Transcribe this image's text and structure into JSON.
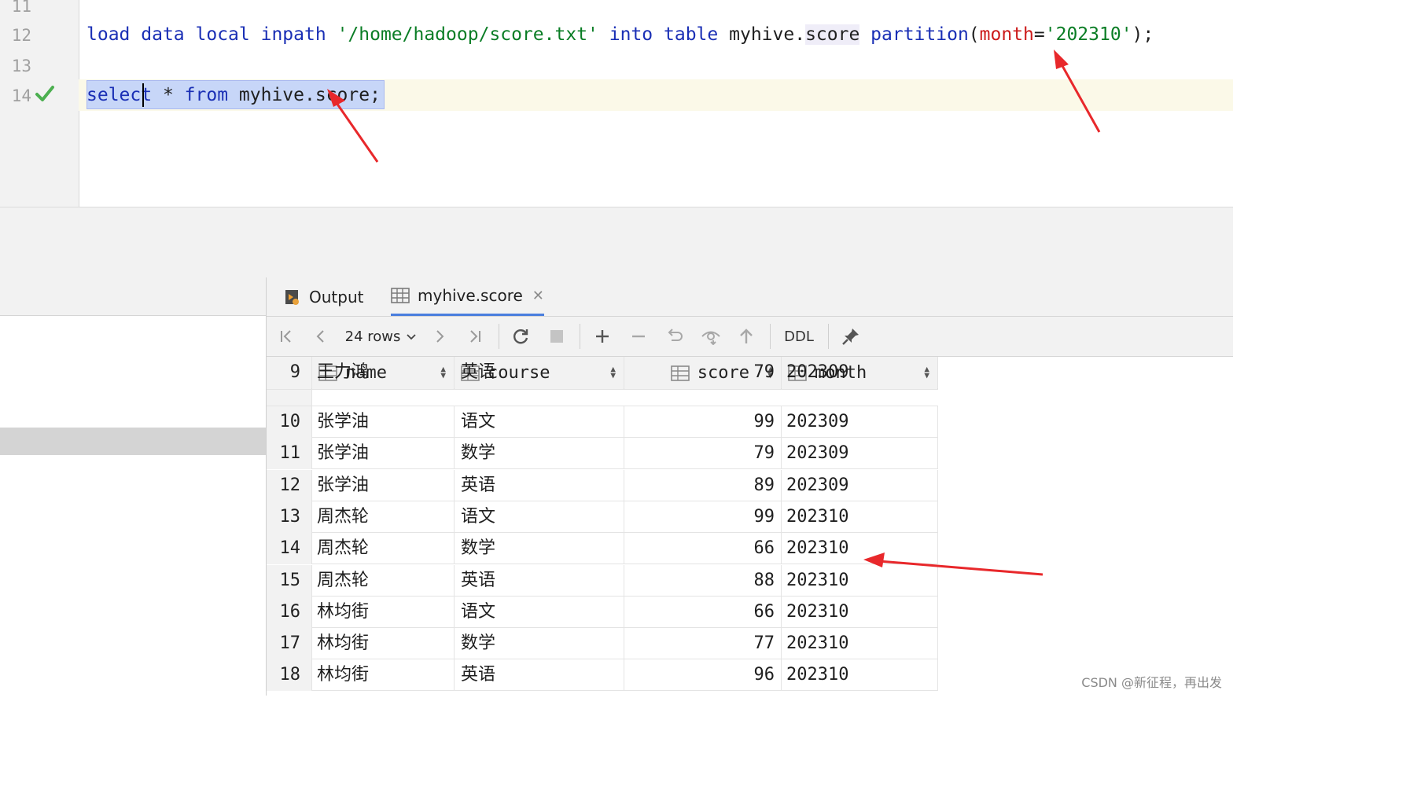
{
  "editor": {
    "line_numbers": [
      "11",
      "12",
      "13",
      "14"
    ],
    "line12": {
      "load": "load",
      "data": "data",
      "local": "local",
      "inpath": "inpath",
      "path": "'/home/hadoop/score.txt'",
      "into": "into",
      "table": "table",
      "table_ref_prefix": "myhive.",
      "table_ref_score": "score",
      "partition": "partition",
      "paren_open": "(",
      "part_key": "month",
      "equals": "=",
      "part_value": "'202310'",
      "tail": ");"
    },
    "line14": {
      "select": "select",
      "star": "*",
      "from": "from",
      "table_ref": "myhive.score",
      "semicolon": ";"
    }
  },
  "tabs": [
    {
      "label": "Output",
      "icon": "output-icon"
    },
    {
      "label": "myhive.score",
      "icon": "table-icon",
      "close": "✕"
    }
  ],
  "toolbar": {
    "rows_label": "24 rows",
    "ddl_label": "DDL",
    "icons": [
      "first-page-icon",
      "prev-page-icon",
      "next-page-icon",
      "last-page-icon",
      "refresh-icon",
      "stop-icon",
      "add-row-icon",
      "remove-row-icon",
      "revert-icon",
      "preview-icon",
      "submit-icon",
      "pin-icon"
    ]
  },
  "grid": {
    "columns": [
      "name",
      "course",
      "score",
      "month"
    ],
    "partial_row": {
      "num": "9",
      "name": "王力鸿",
      "course": "英语",
      "score": "79",
      "month": "202309"
    },
    "rows": [
      {
        "num": "10",
        "name": "张学油",
        "course": "语文",
        "score": "99",
        "month": "202309"
      },
      {
        "num": "11",
        "name": "张学油",
        "course": "数学",
        "score": "79",
        "month": "202309"
      },
      {
        "num": "12",
        "name": "张学油",
        "course": "英语",
        "score": "89",
        "month": "202309"
      },
      {
        "num": "13",
        "name": "周杰轮",
        "course": "语文",
        "score": "99",
        "month": "202310"
      },
      {
        "num": "14",
        "name": "周杰轮",
        "course": "数学",
        "score": "66",
        "month": "202310"
      },
      {
        "num": "15",
        "name": "周杰轮",
        "course": "英语",
        "score": "88",
        "month": "202310"
      },
      {
        "num": "16",
        "name": "林均街",
        "course": "语文",
        "score": "66",
        "month": "202310"
      },
      {
        "num": "17",
        "name": "林均街",
        "course": "数学",
        "score": "77",
        "month": "202310"
      },
      {
        "num": "18",
        "name": "林均街",
        "course": "英语",
        "score": "96",
        "month": "202310"
      }
    ]
  },
  "watermark": "CSDN @新征程，再出发",
  "colors": {
    "keyword": "#1a2fb5",
    "string": "#0a7d25",
    "partition_key": "#cc1b1b",
    "annotation_arrow": "#e8282b",
    "selection": "#c7d6f8"
  }
}
